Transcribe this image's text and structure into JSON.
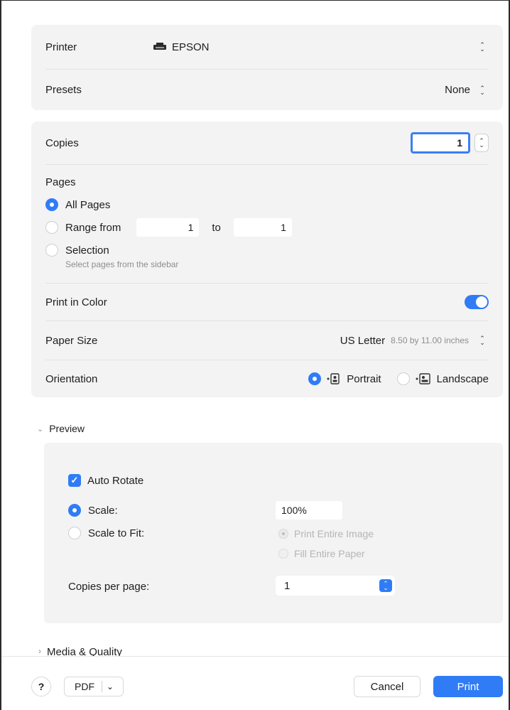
{
  "printer": {
    "label": "Printer",
    "value": "EPSON",
    "icon": "printer-icon"
  },
  "presets": {
    "label": "Presets",
    "value": "None"
  },
  "copies": {
    "label": "Copies",
    "value": "1"
  },
  "pages": {
    "label": "Pages",
    "all_label": "All Pages",
    "range_label": "Range from",
    "range_from": "1",
    "to_label": "to",
    "range_to": "1",
    "selection_label": "Selection",
    "selection_hint": "Select pages from the sidebar"
  },
  "color": {
    "label": "Print in Color",
    "on": true
  },
  "paper": {
    "label": "Paper Size",
    "value": "US Letter",
    "dims": "8.50 by 11.00 inches"
  },
  "orientation": {
    "label": "Orientation",
    "portrait": "Portrait",
    "landscape": "Landscape"
  },
  "preview": {
    "label": "Preview",
    "auto_rotate": "Auto Rotate",
    "scale_label": "Scale:",
    "scale_value": "100%",
    "fit_label": "Scale to Fit:",
    "print_entire": "Print Entire Image",
    "fill_entire": "Fill Entire Paper",
    "copies_per_page_label": "Copies per page:",
    "copies_per_page_value": "1"
  },
  "media": {
    "label": "Media & Quality"
  },
  "footer": {
    "help": "?",
    "pdf": "PDF",
    "cancel": "Cancel",
    "print": "Print"
  },
  "colors": {
    "accent": "#2f7cf6",
    "card": "#f3f3f3"
  }
}
